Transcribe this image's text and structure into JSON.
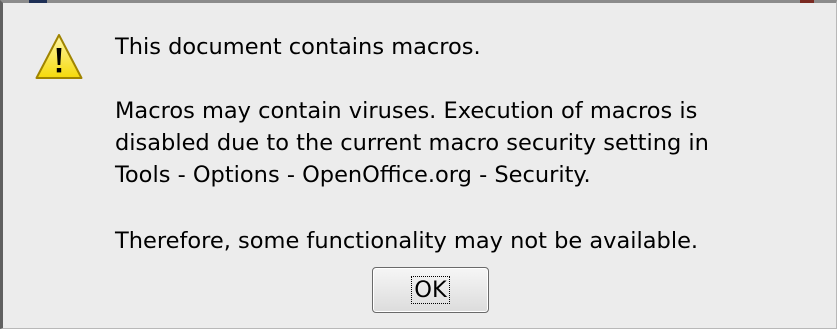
{
  "dialog": {
    "icon": "warning-icon",
    "title_line": "This document contains macros.",
    "body_lines": [
      "Macros may contain viruses. Execution of macros is",
      "disabled due to the current macro security setting in",
      "Tools - Options - OpenOffice.org - Security."
    ],
    "note_line": "Therefore, some functionality may not be available.",
    "ok_label": "OK"
  },
  "colors": {
    "dialog_background": "#ececec",
    "warning_fill": "#fce94f",
    "warning_outline": "#c4a000"
  }
}
